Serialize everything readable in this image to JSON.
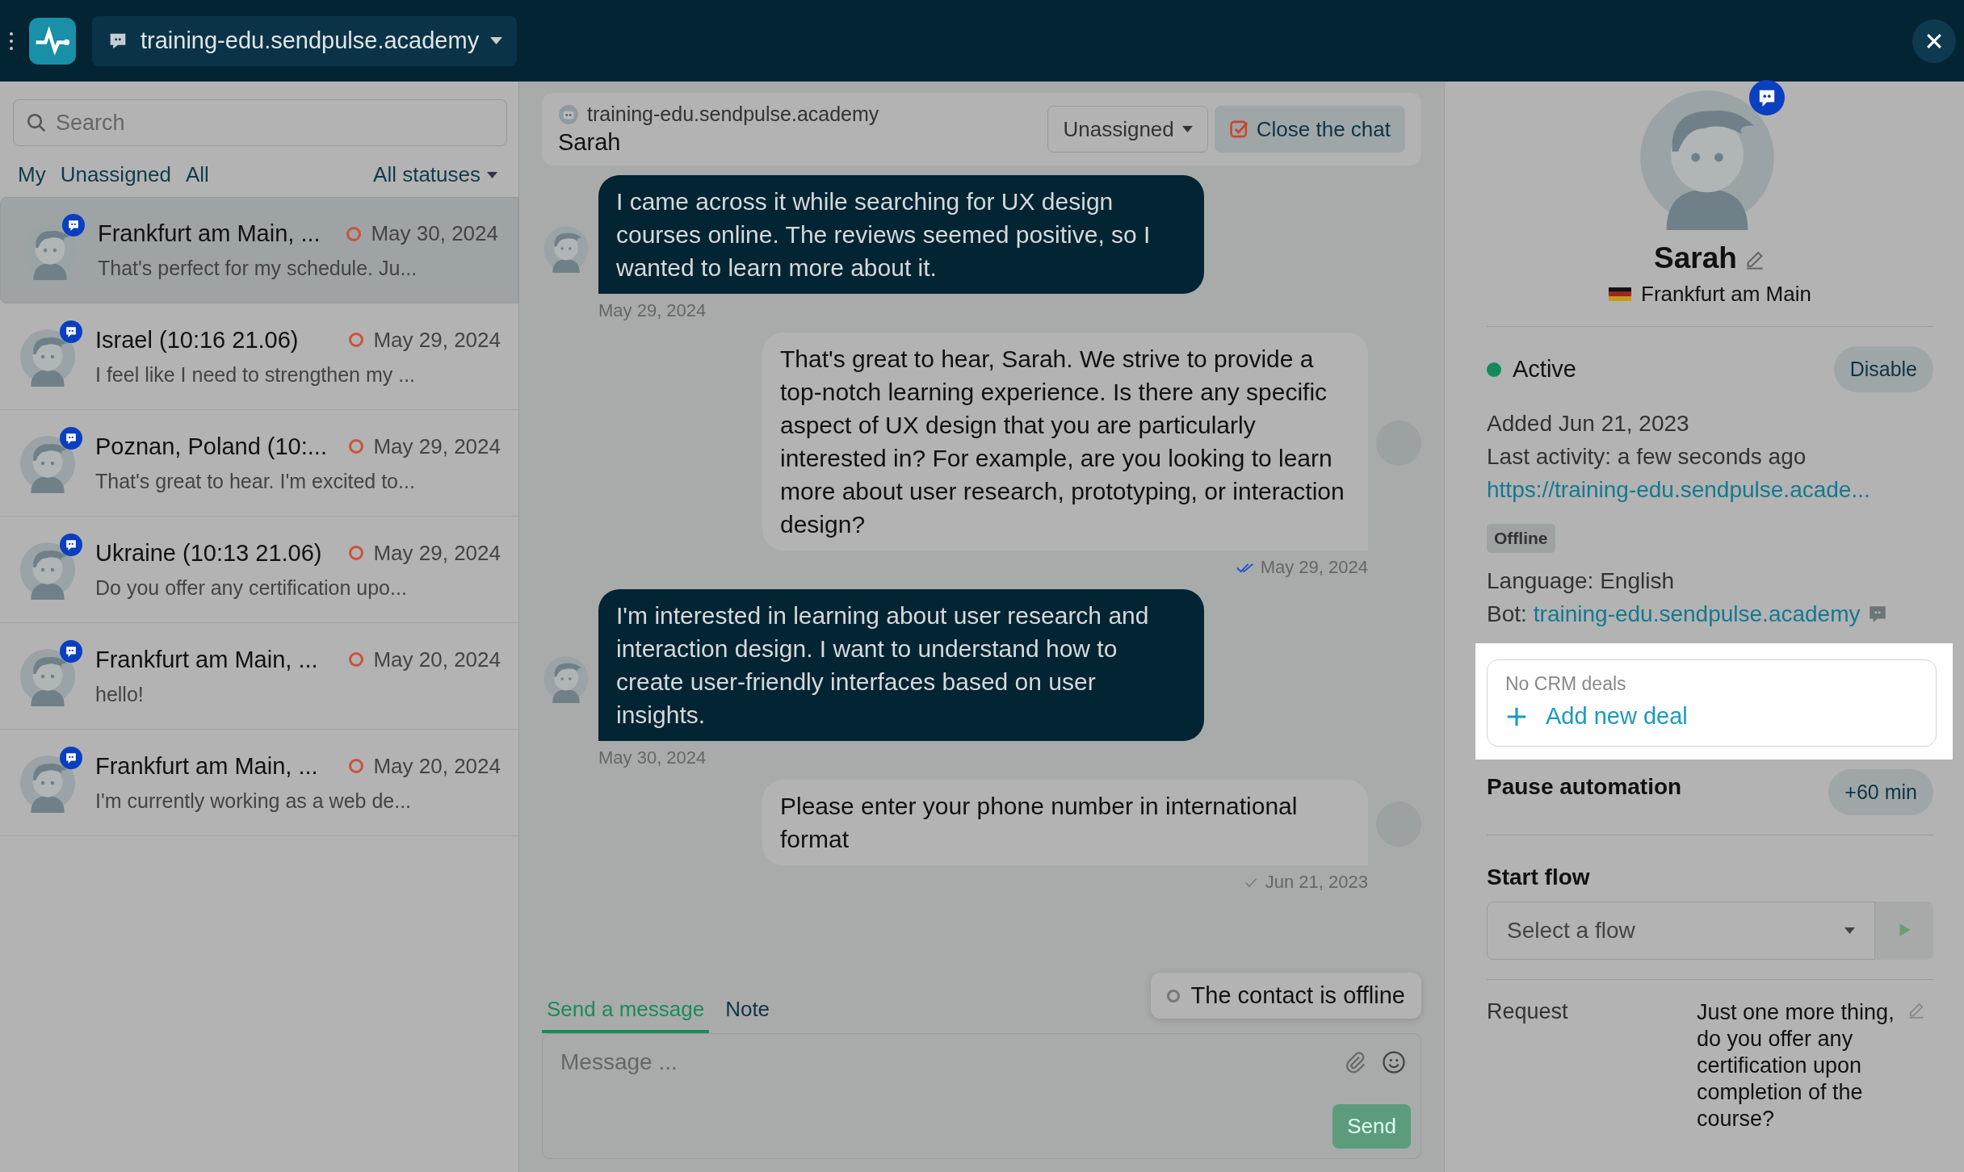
{
  "top_bar": {
    "channel": "training-edu.sendpulse.academy"
  },
  "sidebar": {
    "search_placeholder": "Search",
    "filters": [
      "My",
      "Unassigned",
      "All"
    ],
    "status_filter": "All statuses",
    "conversations": [
      {
        "name": "Frankfurt am Main, ...",
        "date": "May 30, 2024",
        "preview": "That's perfect for my schedule. Ju...",
        "selected": true
      },
      {
        "name": "Israel (10:16 21.06)",
        "date": "May 29, 2024",
        "preview": "I feel like I need to strengthen my ...",
        "selected": false
      },
      {
        "name": "Poznan, Poland (10:...",
        "date": "May 29, 2024",
        "preview": "That's great to hear. I'm excited to...",
        "selected": false
      },
      {
        "name": "Ukraine (10:13 21.06)",
        "date": "May 29, 2024",
        "preview": "Do you offer any certification upo...",
        "selected": false
      },
      {
        "name": "Frankfurt am Main, ...",
        "date": "May 20, 2024",
        "preview": "hello!",
        "selected": false
      },
      {
        "name": "Frankfurt am Main, ...",
        "date": "May 20, 2024",
        "preview": "I'm currently working as a web de...",
        "selected": false
      }
    ]
  },
  "chat": {
    "bot": "training-edu.sendpulse.academy",
    "contact": "Sarah",
    "assignee": "Unassigned",
    "close_button": "Close the chat",
    "messages": [
      {
        "kind": "incoming",
        "text": "I came across it while searching for UX design courses online. The reviews seemed positive, so I wanted to learn more about it.",
        "time": "May 29, 2024"
      },
      {
        "kind": "outgoing",
        "text": "That's great to hear, Sarah. We strive to provide a top-notch learning experience. Is there any specific aspect of UX design that you are particularly interested in? For example, are you looking to learn more about user research, prototyping, or interaction design?",
        "time": "May 29, 2024",
        "read": true
      },
      {
        "kind": "incoming",
        "text": "I'm interested in learning about user research and interaction design. I want to understand how to create user-friendly interfaces based on user insights.",
        "time": "May 30, 2024"
      },
      {
        "kind": "outgoing",
        "text": "Please enter your phone number in international format",
        "time": "Jun 21, 2023",
        "read": false
      }
    ],
    "composer_tabs": [
      {
        "label": "Send a message",
        "selected": true
      },
      {
        "label": "Note",
        "selected": false
      }
    ],
    "message_placeholder": "Message ...",
    "send_button": "Send",
    "tooltip": "The contact is offline"
  },
  "contact": {
    "name": "Sarah",
    "location": "Frankfurt am Main",
    "status": "Active",
    "disable_button": "Disable",
    "added": "Added Jun 21, 2023",
    "last_activity": "Last activity: a few seconds ago",
    "url": "https://training-edu.sendpulse.acade...",
    "badge": "Offline",
    "language": "Language: English",
    "bot_label": "Bot:",
    "bot_link": "training-edu.sendpulse.academy",
    "crm": {
      "highlighted": true,
      "empty_text": "No CRM deals",
      "add_label": "Add new deal"
    },
    "pause": {
      "title": "Pause automation",
      "button": "+60 min"
    },
    "start_flow": {
      "title": "Start flow",
      "placeholder": "Select a flow"
    },
    "request": {
      "label": "Request",
      "value": "Just one more thing, do you offer any certification upon completion of the course?"
    }
  }
}
